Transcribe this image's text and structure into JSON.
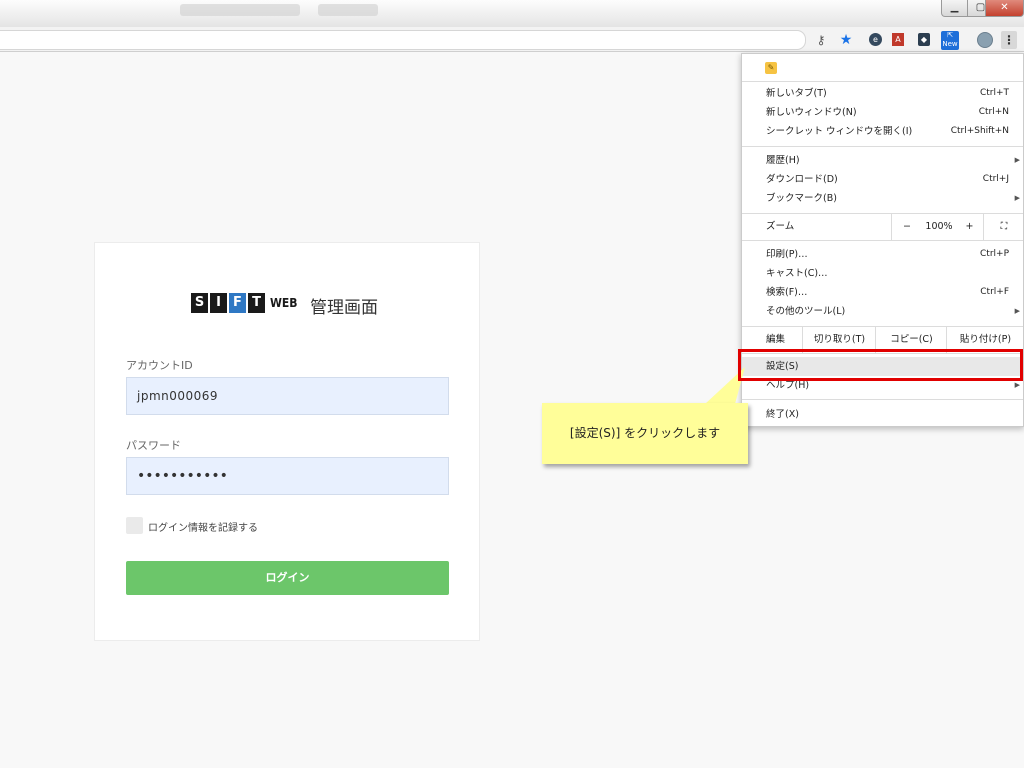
{
  "browser": {
    "menu_glyph": "⋮",
    "ext_new_badge": "New"
  },
  "login": {
    "logo_letters": [
      "S",
      "I",
      "F",
      "T"
    ],
    "logo_suffix": "WEB",
    "title": "管理画面",
    "account_label": "アカウントID",
    "account_value": "jpmn000069",
    "password_label": "パスワード",
    "password_value": "•••••••••••",
    "remember_label": "ログイン情報を記録する",
    "login_button": "ログイン"
  },
  "menu": {
    "new_tab": {
      "label": "新しいタブ(T)",
      "shortcut": "Ctrl+T"
    },
    "new_window": {
      "label": "新しいウィンドウ(N)",
      "shortcut": "Ctrl+N"
    },
    "incognito": {
      "label": "シークレット ウィンドウを開く(I)",
      "shortcut": "Ctrl+Shift+N"
    },
    "history": {
      "label": "履歴(H)"
    },
    "downloads": {
      "label": "ダウンロード(D)",
      "shortcut": "Ctrl+J"
    },
    "bookmarks": {
      "label": "ブックマーク(B)"
    },
    "zoom": {
      "label": "ズーム",
      "minus": "−",
      "value": "100%",
      "plus": "+",
      "fullscreen": "⛶"
    },
    "print": {
      "label": "印刷(P)…",
      "shortcut": "Ctrl+P"
    },
    "cast": {
      "label": "キャスト(C)…"
    },
    "find": {
      "label": "検索(F)…",
      "shortcut": "Ctrl+F"
    },
    "more_tools": {
      "label": "その他のツール(L)"
    },
    "edit": {
      "label": "編集",
      "cut": "切り取り(T)",
      "copy": "コピー(C)",
      "paste": "貼り付け(P)"
    },
    "settings": {
      "label": "設定(S)"
    },
    "help": {
      "label": "ヘルプ(H)"
    },
    "exit": {
      "label": "終了(X)"
    }
  },
  "callout": {
    "text": "[設定(S)] をクリックします"
  },
  "colors": {
    "highlight": "#e10000",
    "callout_bg": "#fffe99",
    "login_button": "#6cc66a",
    "input_bg": "#e8f0fe"
  }
}
